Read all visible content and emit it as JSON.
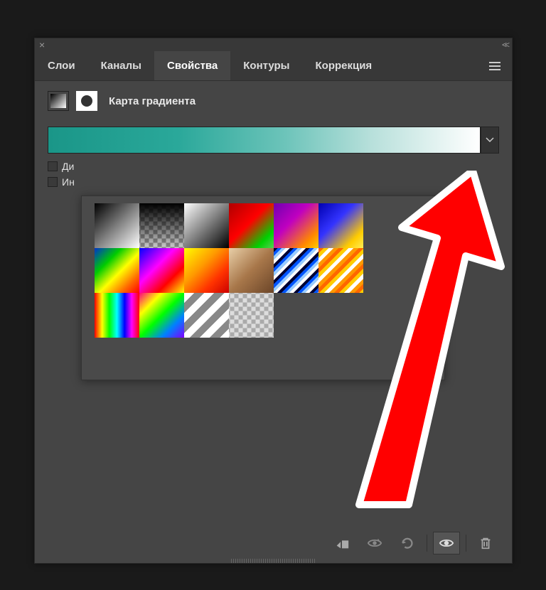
{
  "panel": {
    "close": "×",
    "collapse": "<<"
  },
  "tabs": [
    {
      "label": "Слои"
    },
    {
      "label": "Каналы"
    },
    {
      "label": "Свойства",
      "active": true
    },
    {
      "label": "Контуры"
    },
    {
      "label": "Коррекция"
    }
  ],
  "adjustment": {
    "title": "Карта градиента"
  },
  "checkboxes": [
    {
      "label": "Ди",
      "full": "Дизеринг"
    },
    {
      "label": "Ин",
      "full": "Инверсия"
    }
  ],
  "gradient_presets": [
    "foreground-background",
    "foreground-transparent",
    "white-black",
    "red-green",
    "violet-orange",
    "blue-yellow",
    "blue-red-yellow",
    "blue-magenta-yellow",
    "yellow-orange-red",
    "copper",
    "blue-stripes",
    "orange-stripes",
    "spectrum",
    "rainbow-vivid",
    "white-stripes",
    "transparent"
  ],
  "footer": {
    "clip": "clip-to-layer",
    "view_prev": "view-previous",
    "reset": "reset",
    "toggle": "toggle-visibility",
    "delete": "delete"
  }
}
